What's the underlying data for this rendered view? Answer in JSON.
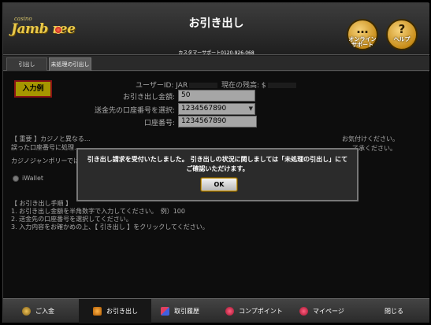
{
  "header": {
    "logo_small": "casino",
    "logo_main": "Jamb  ree",
    "title": "お引き出し",
    "support_line": "カスタマーサポート0120-926-068",
    "support_button": {
      "glyph": "…",
      "label_line1": "オンライン",
      "label_line2": "サポート"
    },
    "help_button": {
      "glyph": "?",
      "label": "ヘルプ"
    }
  },
  "tabs": [
    {
      "label": "引出し"
    },
    {
      "label": "未処理の引出し"
    }
  ],
  "form": {
    "example_badge": "入力例",
    "user_id_label": "ユーザーID: JAR",
    "balance_label": "現在の残高: $",
    "amount_label": "お引き出し金額:",
    "amount_value": "50",
    "account_select_label": "送金先の口座番号を選択:",
    "account_select_value": "1234567890",
    "account_no_label": "口座番号:",
    "account_no_value": "1234567890"
  },
  "notice": {
    "line1": "【 重要 】カジノと異なる...",
    "line2": "誤った口座番号に処理...",
    "right_tail": "了承ください。",
    "line3": "カジノジャンボリーでは",
    "top_right_tail": "お気付けください。"
  },
  "payment": {
    "option_label": "iWallet"
  },
  "steps": {
    "heading": "【 お引き出し手順 】",
    "step1": "1. お引き出し金額を半角数字で入力してください。　例）100",
    "step2": "2. 送金先の口座番号を選択してください。",
    "step3": "3. 入力内容をお確かめの上、【 引き出し 】をクリックしてください。"
  },
  "modal": {
    "message": "引き出し請求を受付いたしました。 引き出しの状況に関しましては「未処理の引出し」にてご確認いただけます。",
    "ok_label": "OK"
  },
  "bottom_nav": [
    {
      "label": "ご入金"
    },
    {
      "label": "お引き出し"
    },
    {
      "label": "取引履歴"
    },
    {
      "label": "コンプポイント"
    },
    {
      "label": "マイページ"
    },
    {
      "label": "閉じる"
    }
  ]
}
